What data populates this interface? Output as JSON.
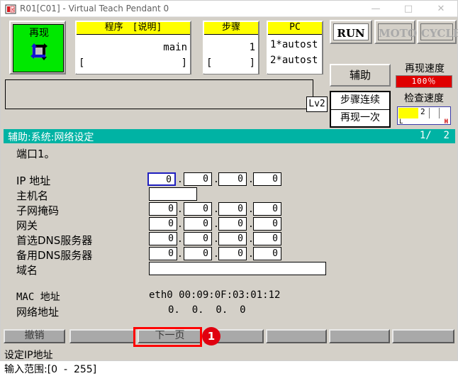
{
  "window": {
    "title": "R01[C01] - Virtual Teach Pendant 0",
    "minimize": "—",
    "maximize": "□",
    "close": "✕"
  },
  "toolbar": {
    "mode_button": {
      "label": "再现",
      "icon": "cycle-arrows-icon",
      "color": "#00e800"
    },
    "program_box": {
      "header": "程序　[说明]",
      "value": "main",
      "bracket_left": "[",
      "bracket_right": "]"
    },
    "step_box": {
      "header": "步骤",
      "value": "1",
      "bracket_left": "[",
      "bracket_right": "]"
    },
    "pc_box": {
      "header": "PC",
      "line1": "1*autost",
      "line2": "2*autost"
    },
    "message_area": "",
    "lv_indicator": "Lv2",
    "run_button": "RUN",
    "motor_button": "MOTOR",
    "cycle_button": "CYCLE",
    "aux_button": "辅助",
    "step_mode": {
      "line1": "步骤连续",
      "line2": "再现一次"
    },
    "play_speed": {
      "label": "再现速度",
      "value": "100％",
      "color": "#e00000"
    },
    "check_speed": {
      "label": "检查速度",
      "value": "2",
      "min_label": "L",
      "max_label": "H",
      "fill_percent": 38
    }
  },
  "statusbar": {
    "path": "辅助:系统:网络设定",
    "page": "1/  2",
    "color": "#00b3a4"
  },
  "content": {
    "port_text": "端口1。",
    "ip_address": {
      "label": "IP 地址",
      "octets": [
        "0",
        "0",
        "0",
        "0"
      ],
      "focused_index": 0
    },
    "hostname": {
      "label": "主机名",
      "value": ""
    },
    "subnet_mask": {
      "label": "子网掩码",
      "octets": [
        "0",
        "0",
        "0",
        "0"
      ]
    },
    "gateway": {
      "label": "网关",
      "octets": [
        "0",
        "0",
        "0",
        "0"
      ]
    },
    "dns_primary": {
      "label": "首选DNS服务器",
      "octets": [
        "0",
        "0",
        "0",
        "0"
      ]
    },
    "dns_backup": {
      "label": "备用DNS服务器",
      "octets": [
        "0",
        "0",
        "0",
        "0"
      ]
    },
    "domain": {
      "label": "域名",
      "value": ""
    },
    "mac_address": {
      "label": "MAC 地址",
      "value": "eth0 00:09:0F:03:01:12"
    },
    "net_address": {
      "label": "网络地址",
      "value": "0.  0.  0.  0"
    },
    "separator": "."
  },
  "softkeys": [
    {
      "label": "撤销",
      "highlighted": false
    },
    {
      "label": "",
      "highlighted": false
    },
    {
      "label": "下一页",
      "highlighted": true
    },
    {
      "label": "",
      "highlighted": false
    },
    {
      "label": "",
      "highlighted": false
    },
    {
      "label": "",
      "highlighted": false
    },
    {
      "label": "",
      "highlighted": false
    }
  ],
  "annotation": {
    "badge": "1",
    "color": "#e00010"
  },
  "bottom": {
    "line1": "设定IP地址",
    "line2": "输入范围:[0  -  255]"
  }
}
